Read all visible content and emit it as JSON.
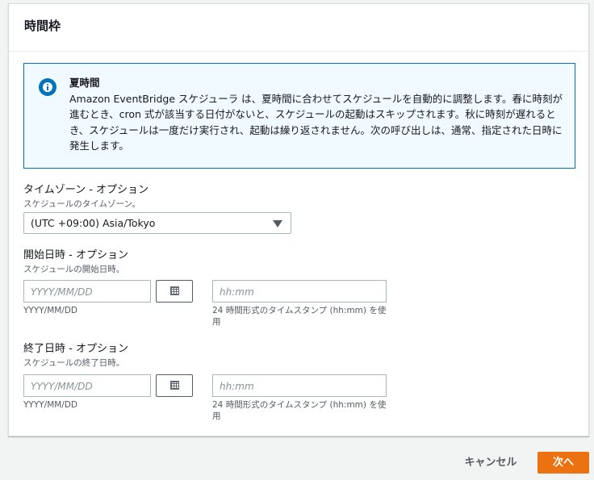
{
  "panel": {
    "title": "時間枠"
  },
  "info": {
    "icon": "info-icon",
    "heading": "夏時間",
    "body": "Amazon EventBridge スケジューラ は、夏時間に合わせてスケジュールを自動的に調整します。春に時刻が進むとき、cron 式が該当する日付がないと、スケジュールの起動はスキップされます。秋に時刻が遅れるとき、スケジュールは一度だけ実行され、起動は繰り返されません。次の呼び出しは、通常、指定された日時に発生します。"
  },
  "timezone": {
    "label": "タイムゾーン - オプション",
    "description": "スケジュールのタイムゾーン。",
    "value": "(UTC +09:00) Asia/Tokyo"
  },
  "start": {
    "label": "開始日時 - オプション",
    "description": "スケジュールの開始日時。",
    "date_placeholder": "YYYY/MM/DD",
    "date_hint": "YYYY/MM/DD",
    "time_placeholder": "hh:mm",
    "time_hint": "24 時間形式のタイムスタンプ (hh:mm) を使用"
  },
  "end": {
    "label": "終了日時 - オプション",
    "description": "スケジュールの終了日時。",
    "date_placeholder": "YYYY/MM/DD",
    "date_hint": "YYYY/MM/DD",
    "time_placeholder": "hh:mm",
    "time_hint": "24 時間形式のタイムスタンプ (hh:mm) を使用"
  },
  "footer": {
    "cancel_label": "キャンセル",
    "next_label": "次へ"
  },
  "colors": {
    "accent": "#ec7211",
    "info": "#0073bb",
    "info_bg": "#f1faff"
  }
}
